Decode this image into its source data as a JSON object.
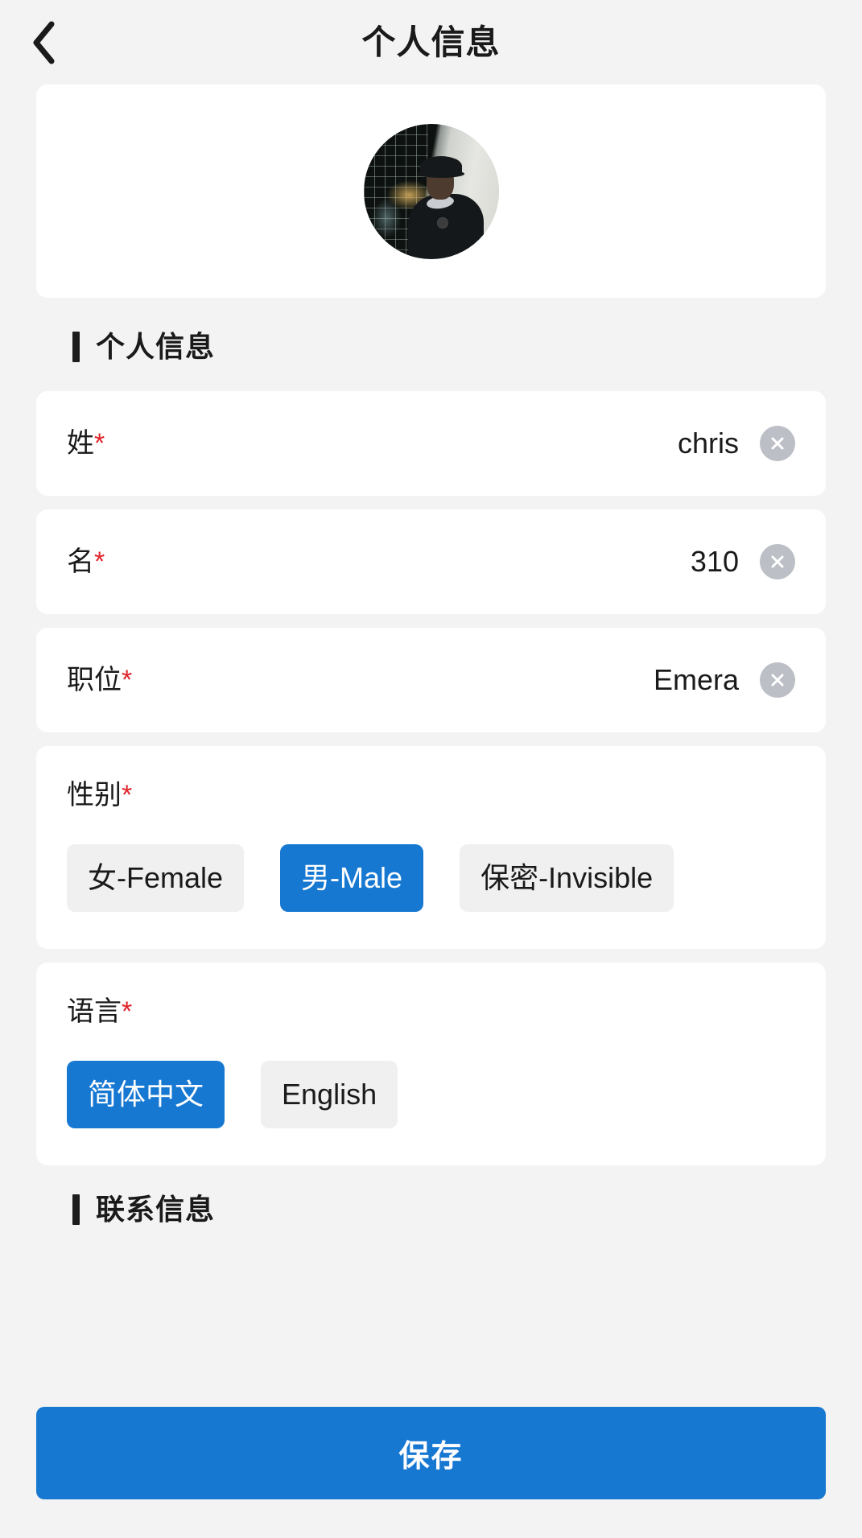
{
  "header": {
    "back_icon": "chevron-left-icon",
    "title": "个人信息"
  },
  "avatar": {
    "alt": "user-avatar-photo"
  },
  "sections": {
    "personal": {
      "title": "个人信息"
    },
    "contact": {
      "title": "联系信息"
    }
  },
  "fields": [
    {
      "label": "姓",
      "required_mark": "*",
      "value": "chris",
      "clear_icon": "close-circle-icon"
    },
    {
      "label": "名",
      "required_mark": "*",
      "value": "310",
      "clear_icon": "close-circle-icon"
    },
    {
      "label": "职位",
      "required_mark": "*",
      "value": "Emera",
      "clear_icon": "close-circle-icon"
    }
  ],
  "gender": {
    "label": "性别",
    "required_mark": "*",
    "options": [
      {
        "label": "女-Female",
        "selected": false
      },
      {
        "label": "男-Male",
        "selected": true
      },
      {
        "label": "保密-Invisible",
        "selected": false
      }
    ]
  },
  "language": {
    "label": "语言",
    "required_mark": "*",
    "options": [
      {
        "label": "简体中文",
        "selected": true
      },
      {
        "label": "English",
        "selected": false
      }
    ]
  },
  "save": {
    "label": "保存"
  },
  "colors": {
    "accent_blue": "#1778d2",
    "required_red": "#e0242a",
    "page_background": "#f3f3f3",
    "card_background": "#ffffff",
    "pill_inactive": "#f0f0f0",
    "clear_button_gray": "#bcbfc6",
    "text_primary": "#1a1a1a"
  }
}
